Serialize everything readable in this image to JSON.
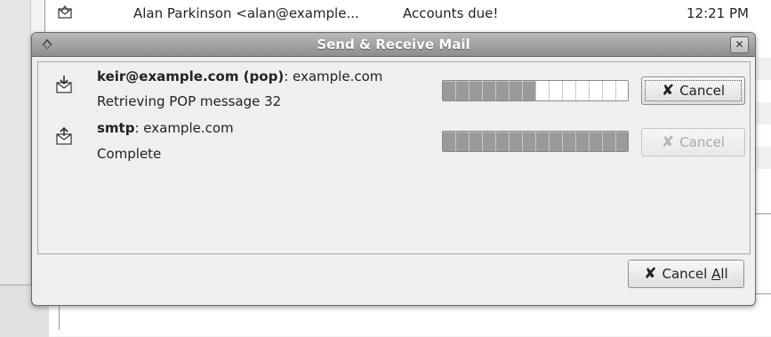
{
  "background": {
    "row": {
      "from": "Alan Parkinson <alan@example...",
      "subject": "Accounts due!",
      "time": "12:21 PM"
    }
  },
  "dialog": {
    "title": "Send & Receive Mail",
    "close_label": "✕",
    "accounts": [
      {
        "name_bold": "keir@example.com (pop)",
        "name_rest": ": example.com",
        "status": "Retrieving POP message 32",
        "progress": 0.5,
        "cancel_label": "Cancel",
        "cancel_enabled": true,
        "icon": "mail-receive-icon"
      },
      {
        "name_bold": "smtp",
        "name_rest": ": example.com",
        "status": "Complete",
        "progress": 1.0,
        "cancel_label": "Cancel",
        "cancel_enabled": false,
        "icon": "mail-send-icon"
      }
    ],
    "cancel_all": {
      "prefix": "Cancel ",
      "underlined": "A",
      "suffix": "ll"
    }
  },
  "colors": {
    "titlebar": "#9e9e9e",
    "progress_fill": "#9a9a9a",
    "dialog_bg": "#efefef"
  }
}
